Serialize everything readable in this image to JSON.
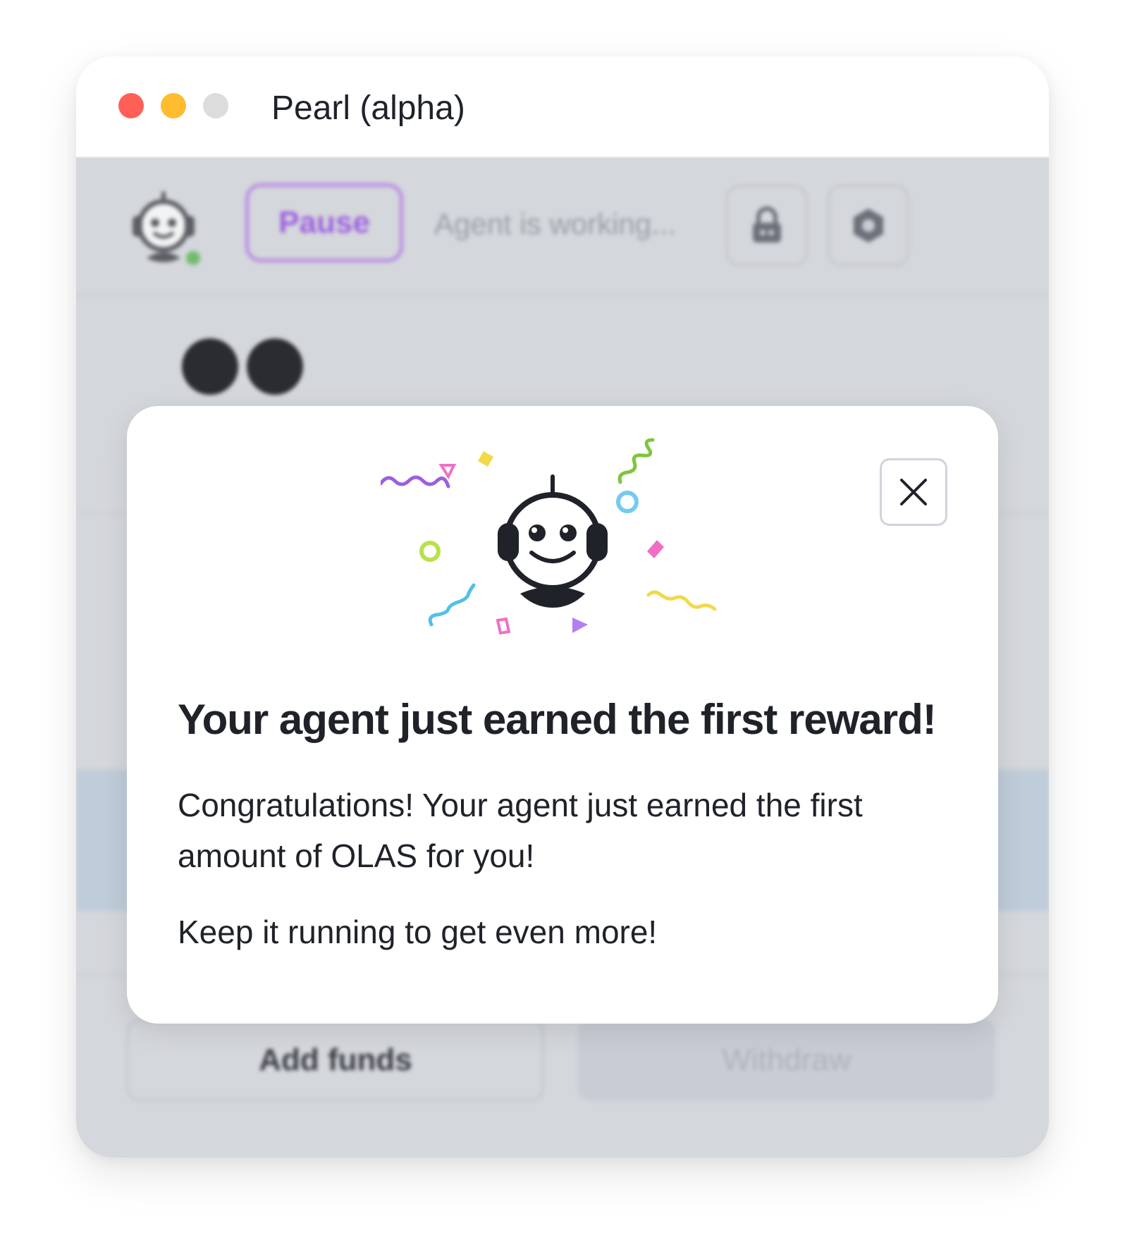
{
  "window": {
    "title": "Pearl (alpha)"
  },
  "background": {
    "pause_label": "Pause",
    "status_text": "Agent is working...",
    "add_funds_label": "Add funds",
    "withdraw_label": "Withdraw",
    "icons": [
      "robot-avatar-icon",
      "lock-icon",
      "settings-icon"
    ]
  },
  "modal": {
    "heading": "Your agent just earned the first reward!",
    "paragraph1": "Congratulations! Your agent just earned the first amount of OLAS for you!",
    "paragraph2": "Keep it running to get even more!",
    "close_icon": "close-icon",
    "illustration": "celebrating-robot-icon"
  },
  "colors": {
    "accent_purple": "#9d5fe0",
    "traffic_red": "#ff5f57",
    "traffic_yellow": "#febc2e",
    "status_green": "#4caf3f"
  }
}
